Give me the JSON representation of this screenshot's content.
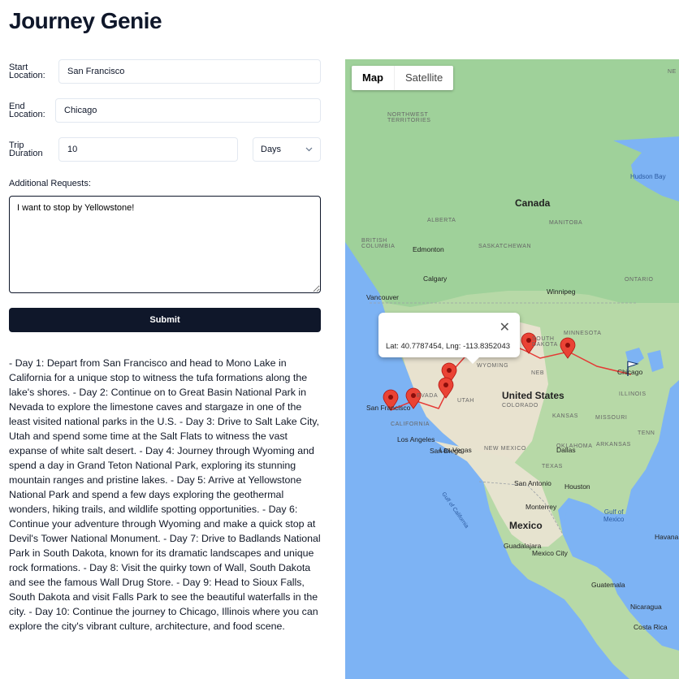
{
  "app": {
    "title": "Journey Genie"
  },
  "form": {
    "start_label": "Start Location:",
    "start_value": "San Francisco",
    "end_label": "End Location:",
    "end_value": "Chicago",
    "duration_label": "Trip Duration",
    "duration_value": "10",
    "duration_unit": "Days",
    "requests_label": "Additional Requests:",
    "requests_value": "I want to stop by Yellowstone!",
    "submit_label": "Submit"
  },
  "itinerary": "- Day 1: Depart from San Francisco and head to Mono Lake in California for a unique stop to witness the tufa formations along the lake's shores. - Day 2: Continue on to Great Basin National Park in Nevada to explore the limestone caves and stargaze in one of the least visited national parks in the U.S. - Day 3: Drive to Salt Lake City, Utah and spend some time at the Salt Flats to witness the vast expanse of white salt desert. - Day 4: Journey through Wyoming and spend a day in Grand Teton National Park, exploring its stunning mountain ranges and pristine lakes. - Day 5: Arrive at Yellowstone National Park and spend a few days exploring the geothermal wonders, hiking trails, and wildlife spotting opportunities. - Day 6: Continue your adventure through Wyoming and make a quick stop at Devil's Tower National Monument. - Day 7: Drive to Badlands National Park in South Dakota, known for its dramatic landscapes and unique rock formations. - Day 8: Visit the quirky town of Wall, South Dakota and see the famous Wall Drug Store. - Day 9: Head to Sioux Falls, South Dakota and visit Falls Park to see the beautiful waterfalls in the city. - Day 10: Continue the journey to Chicago, Illinois where you can explore the city's vibrant culture, architecture, and food scene.",
  "map": {
    "tab_map": "Map",
    "tab_satellite": "Satellite",
    "info_text": "Lat: 40.7787454, Lng: -113.8352043",
    "info_close": "✕",
    "labels": {
      "canada": "Canada",
      "united_states": "United States",
      "mexico": "Mexico",
      "nw_territories": "NORTHWEST\nTERRITORIES",
      "alberta": "ALBERTA",
      "manitoba": "MANITOBA",
      "british_columbia": "BRITISH\nCOLUMBIA",
      "saskatchewan": "SASKATCHEWAN",
      "ontario": "ONTARIO",
      "minnesota": "MINNESOTA",
      "wyoming": "WYOMING",
      "nevada": "EVADA",
      "utah": "UTAH",
      "colorado": "COLORADO",
      "california": "CALIFORNIA",
      "kansas": "KANSAS",
      "illinois": "ILLINOIS",
      "missouri": "MISSOURI",
      "oklahoma": "OKLAHOMA",
      "new_mexico": "NEW MEXICO",
      "texas": "TEXAS",
      "south_dakota": "SOUTH\nDAKOTA",
      "nebraska": "NEB",
      "arkansas": "ARKANSAS",
      "tennessee": "TENN",
      "edmonton": "Edmonton",
      "calgary": "Calgary",
      "vancouver": "Vancouver",
      "winnipeg": "Winnipeg",
      "chicago": "Chicago",
      "san_francisco": "San Francisco",
      "los_angeles": "Los Angeles",
      "las_vegas": "Las Vegas",
      "san_diego": "San Diego",
      "dallas": "Dallas",
      "houston": "Houston",
      "san_antonio": "San Antonio",
      "monterrey": "Monterrey",
      "guadalajara": "Guadalajara",
      "mexico_city": "Mexico City",
      "guatemala": "Guatemala",
      "nicaragua": "Nicaragua",
      "costa_rica": "Costa Rica",
      "havana": "Havana",
      "hudson_bay": "Hudson Bay",
      "gulf_of_mexico": "Gulf of\nMexico",
      "gulf_of_california": "Gulf of California",
      "ne": "NE"
    }
  }
}
